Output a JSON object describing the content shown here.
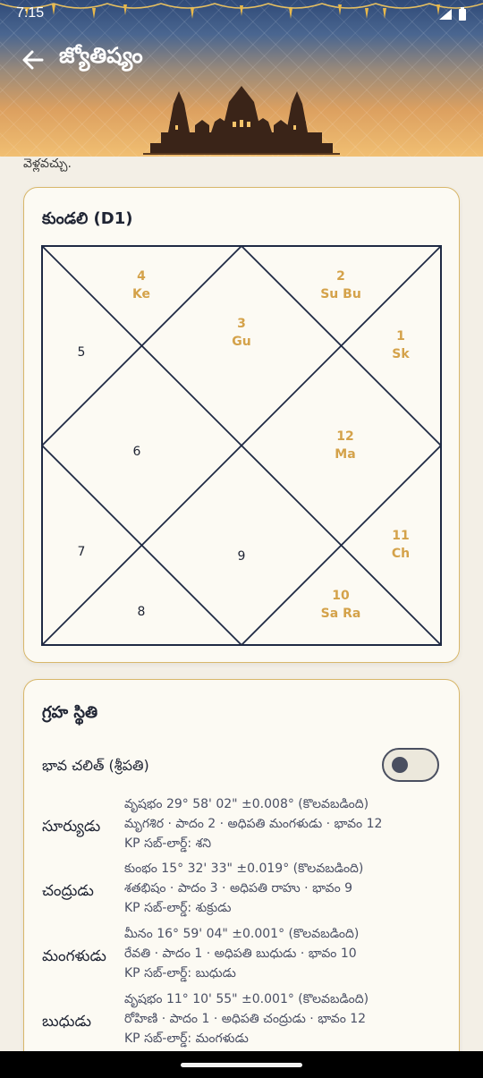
{
  "status": {
    "time": "7:15"
  },
  "appbar": {
    "title": "జ్యోతిష్యం"
  },
  "prev_text": "వెళ్లవచ్చు.",
  "kundali": {
    "title": "కుండలి (D1)",
    "houses": [
      {
        "num": "4",
        "planets": "Ke",
        "highlight": true
      },
      {
        "num": "2",
        "planets": "Su Bu",
        "highlight": true
      },
      {
        "num": "3",
        "planets": "Gu",
        "highlight": true
      },
      {
        "num": "1",
        "planets": "Sk",
        "highlight": true
      },
      {
        "num": "5",
        "planets": "",
        "highlight": false
      },
      {
        "num": "6",
        "planets": "",
        "highlight": false
      },
      {
        "num": "12",
        "planets": "Ma",
        "highlight": true
      },
      {
        "num": "7",
        "planets": "",
        "highlight": false
      },
      {
        "num": "9",
        "planets": "",
        "highlight": false
      },
      {
        "num": "11",
        "planets": "Ch",
        "highlight": true
      },
      {
        "num": "8",
        "planets": "",
        "highlight": false
      },
      {
        "num": "10",
        "planets": "Sa Ra",
        "highlight": true
      }
    ],
    "colors": {
      "highlight": "#d4a24a",
      "plain": "#1f2433",
      "lines": "#1f2a44"
    }
  },
  "graha": {
    "title": "గ్రహ స్థితి",
    "toggle_label": "భావ చలిత్ (శ్రీపతి)",
    "toggle_on": false,
    "planets": [
      {
        "name": "సూర్యుడు",
        "line1": "వృషభం 29° 58' 02\"  ±0.008° (కొలవబడింది)",
        "line2": "మృగశిర · పాదం 2 · అధిపతి మంగళుడు · భావం 12",
        "line3": "KP సబ్-లార్డ్: శని"
      },
      {
        "name": "చంద్రుడు",
        "line1": "కుంభం 15° 32' 33\"  ±0.019° (కొలవబడింది)",
        "line2": "శతభిషం · పాదం 3 · అధిపతి రాహు · భావం 9",
        "line3": "KP సబ్-లార్డ్: శుక్రుడు"
      },
      {
        "name": "మంగళుడు",
        "line1": "మీనం 16° 59' 04\"  ±0.001° (కొలవబడింది)",
        "line2": "రేవతి · పాదం 1 · అధిపతి బుధుడు · భావం 10",
        "line3": "KP సబ్-లార్డ్: బుధుడు"
      },
      {
        "name": "బుధుడు",
        "line1": "వృషభం 11° 10' 55\"  ±0.001° (కొలవబడింది)",
        "line2": "రోహిణి · పాదం 1 · అధిపతి చంద్రుడు · భావం 12",
        "line3": "KP సబ్-లార్డ్: మంగళుడు"
      }
    ]
  }
}
